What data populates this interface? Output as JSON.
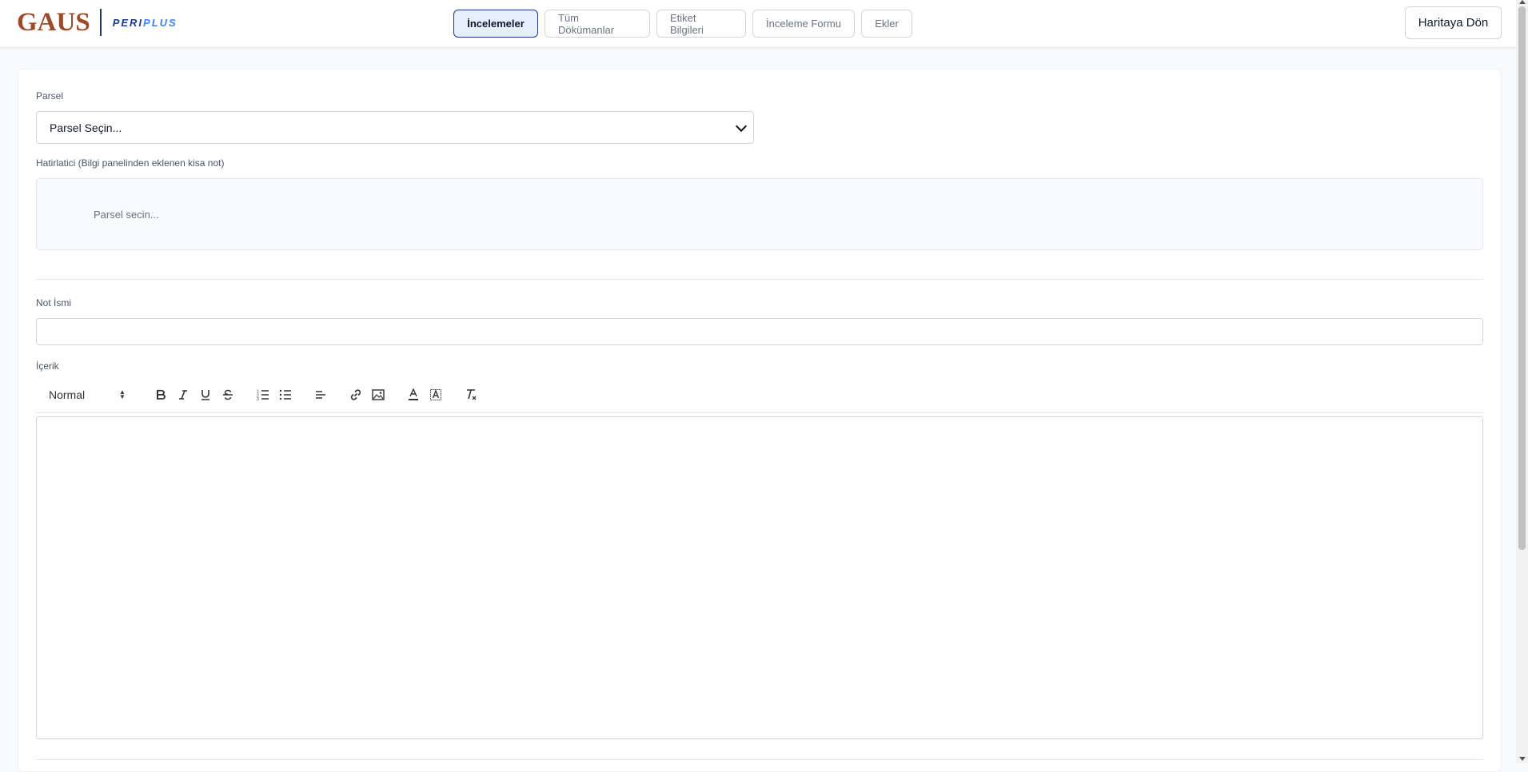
{
  "header": {
    "logo_main": "GAUS",
    "logo_sub_a": "PERI",
    "logo_sub_b": "PLUS",
    "tabs": [
      {
        "label": "İncelemeler",
        "active": true
      },
      {
        "label": "Tüm Dökümanlar",
        "active": false
      },
      {
        "label": "Etiket Bilgileri",
        "active": false
      },
      {
        "label": "İnceleme Formu",
        "active": false
      },
      {
        "label": "Ekler",
        "active": false
      }
    ],
    "back_button": "Haritaya Dön"
  },
  "form": {
    "parcel_label": "Parsel",
    "parcel_select_value": "Parsel Seçin...",
    "reminder_label": "Hatirlatici (Bilgi panelinden eklenen kisa not)",
    "reminder_text": "Parsel secin...",
    "note_name_label": "Not İsmi",
    "note_name_value": "",
    "content_label": "İçerik"
  },
  "editor": {
    "format_value": "Normal",
    "tools": [
      "bold-icon",
      "italic-icon",
      "underline-icon",
      "strikethrough-icon",
      "ordered-list-icon",
      "bullet-list-icon",
      "align-icon",
      "link-icon",
      "image-icon",
      "text-color-icon",
      "background-color-icon",
      "clear-format-icon"
    ]
  },
  "colors": {
    "brand_gaus": "#9c4a2a",
    "brand_navy": "#1e3a8a",
    "active_tab_bg": "#e6effd"
  }
}
